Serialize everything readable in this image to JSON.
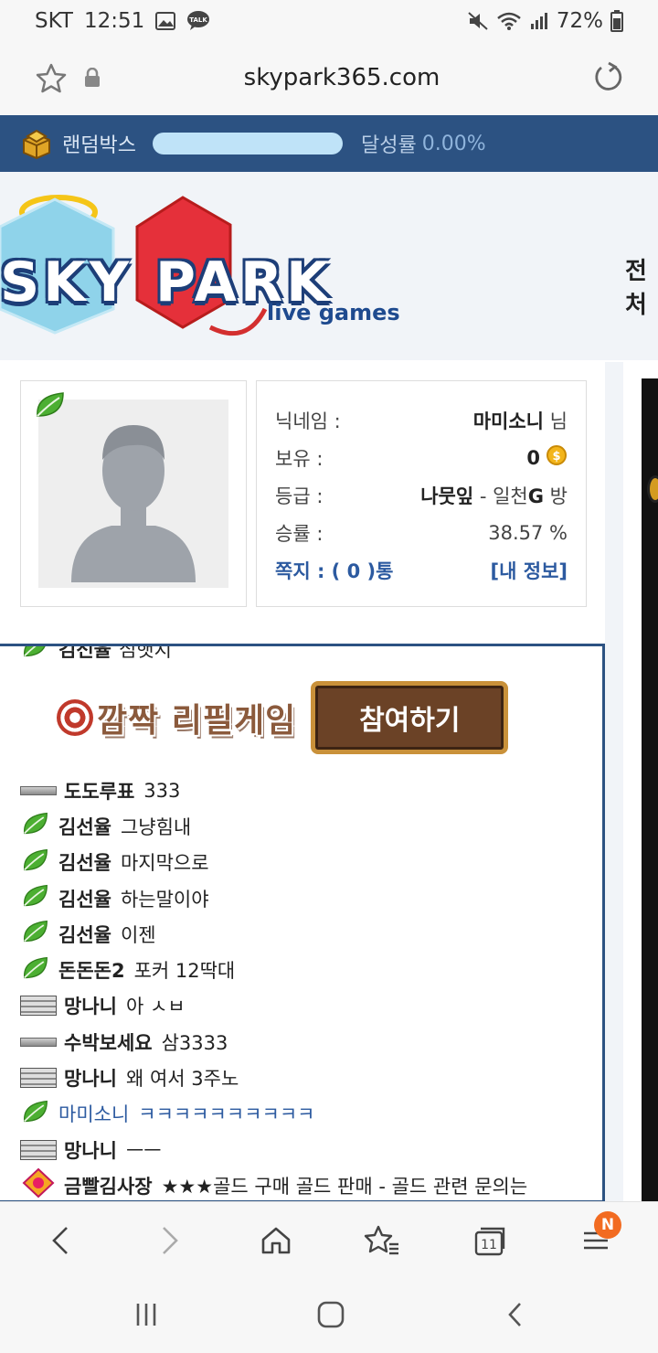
{
  "status_bar": {
    "carrier": "SKT",
    "time": "12:51",
    "battery": "72%",
    "talk_badge": "TALK"
  },
  "browser": {
    "url": "skypark365.com"
  },
  "random_box": {
    "label": "랜덤박스",
    "achieve_label": "달성률",
    "achieve_value": "0.00%",
    "progress": 0.0
  },
  "logo": {
    "main": "SKY PARK",
    "sub": "live games",
    "cut_text": "전처"
  },
  "profile": {
    "rows": [
      {
        "label": "닉네임 :",
        "value": "마미소니",
        "suffix": " 님"
      },
      {
        "label": "보유 :",
        "value": "0"
      },
      {
        "label": "등급 :",
        "value": "나뭇잎",
        "suffix": " - 일천",
        "extra": "G",
        "extra2": " 방"
      },
      {
        "label": "승률 :",
        "value": "38.57 %"
      }
    ],
    "message_link": "쪽지 : ( 0 )통",
    "my_info_link": "[내 정보]"
  },
  "chat": {
    "top_cut": {
      "nick": "김선율",
      "msg": "심햇지"
    },
    "banner_title": "깜짝 리필게임",
    "join_label": "참여하기",
    "lines": [
      {
        "rank": "bar-small",
        "nick": "도도루표",
        "msg": "333"
      },
      {
        "rank": "leaf",
        "nick": "김선율",
        "msg": "그냥힘내"
      },
      {
        "rank": "leaf",
        "nick": "김선율",
        "msg": "마지막으로"
      },
      {
        "rank": "leaf",
        "nick": "김선율",
        "msg": "하는말이야"
      },
      {
        "rank": "leaf",
        "nick": "김선율",
        "msg": "이젠"
      },
      {
        "rank": "leaf",
        "nick": "돈돈돈2",
        "msg": "포커 12딱대"
      },
      {
        "rank": "bar-big",
        "nick": "망나니",
        "msg": "아 ㅅㅂ"
      },
      {
        "rank": "bar-small",
        "nick": "수박보세요",
        "msg": "삼3333"
      },
      {
        "rank": "bar-big",
        "nick": "망나니",
        "msg": "왜 여서 3주노"
      },
      {
        "rank": "leaf",
        "nick": "마미소니",
        "msg": "ㅋㅋㅋㅋㅋㅋㅋㅋㅋㅋ",
        "mine": true
      },
      {
        "rank": "bar-big",
        "nick": "망나니",
        "msg": "ㅡㅡ"
      },
      {
        "rank": "badge",
        "nick": "금빨김사장",
        "msg": "★★★골드 구매 골드 판매 - 골드 관련 문의는"
      }
    ]
  },
  "bottom_nav": {
    "tabs_count": "11",
    "menu_badge": "N"
  },
  "colors": {
    "brand_blue": "#2c5282",
    "link_blue": "#2c5aa0",
    "leaf_green": "#4caf32",
    "badge_orange": "#f26b21"
  }
}
